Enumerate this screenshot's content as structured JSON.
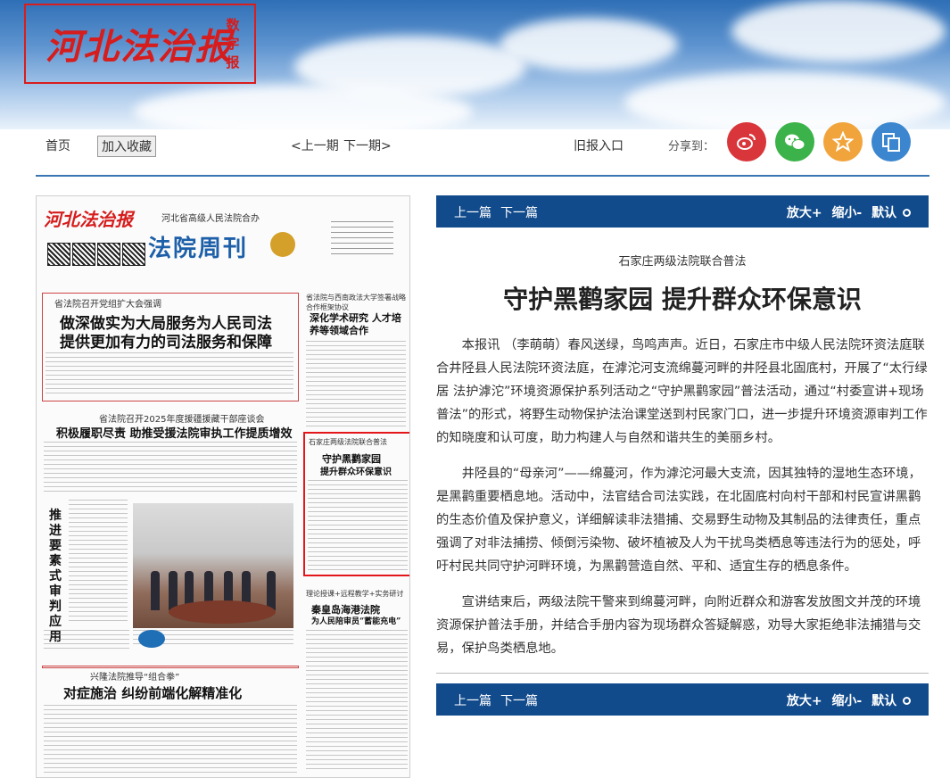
{
  "header": {
    "logo_text": "河北法治报",
    "logo_side": "数字报"
  },
  "nav": {
    "home": "首页",
    "favorite": "加入收藏",
    "prev_issue": "<上一期",
    "next_issue": "下一期>",
    "old_entry": "旧报入口",
    "share_label": "分享到："
  },
  "share": [
    {
      "name": "weibo",
      "color": "#d9363b"
    },
    {
      "name": "wechat",
      "color": "#3cb34a"
    },
    {
      "name": "qzone",
      "color": "#f1a43b"
    },
    {
      "name": "copy",
      "color": "#3b86cf"
    }
  ],
  "paper": {
    "logo": "河北法治报",
    "court": "河北省高级人民法院合办",
    "title": "法院周刊",
    "kicker1": "省法院召开党组扩大会强调",
    "headline1a": "做深做实为大局服务为人民司法",
    "headline1b": "提供更加有力的司法服务和保障",
    "kicker2": "省法院与西南政法大学签署战略合作框架协议",
    "headline2": "深化学术研究 人才培养等领域合作",
    "kicker3": "省法院召开2025年度援疆援藏干部座谈会",
    "headline3": "积极履职尽责 助推受援法院审执工作提质增效",
    "kicker4": "石家庄两级法院联合普法",
    "headline4a": "守护黑鹳家园",
    "headline4b": "提升群众环保意识",
    "headline5": "推进要素式审判 应用",
    "kicker6": "理论授课+远程教学+实务研讨",
    "headline6a": "秦皇岛海港法院",
    "headline6b": "为人民陪审员“蓄能充电”",
    "kicker7": "兴隆法院推导“组合拳”",
    "headline7": "对症施治 纠纷前端化解精准化"
  },
  "article_nav": {
    "prev": "上一篇",
    "next": "下一篇",
    "zoom_in": "放大+",
    "zoom_out": "缩小-",
    "default": "默认"
  },
  "article": {
    "kicker": "石家庄两级法院联合普法",
    "title": "守护黑鹳家园 提升群众环保意识",
    "p1": "本报讯 （李萌萌）春风送绿，鸟鸣声声。近日，石家庄市中级人民法院环资法庭联合井陉县人民法院环资法庭，在滹沱河支流绵蔓河畔的井陉县北固底村，开展了“太行绿居 法护滹沱”环境资源保护系列活动之“守护黑鹳家园”普法活动，通过“村委宣讲+现场普法”的形式，将野生动物保护法治课堂送到村民家门口，进一步提升环境资源审判工作的知晓度和认可度，助力构建人与自然和谐共生的美丽乡村。",
    "p2": "井陉县的“母亲河”——绵蔓河，作为滹沱河最大支流，因其独特的湿地生态环境，是黑鹳重要栖息地。活动中，法官结合司法实践，在北固底村向村干部和村民宣讲黑鹳的生态价值及保护意义，详细解读非法猎捕、交易野生动物及其制品的法律责任，重点强调了对非法捕捞、倾倒污染物、破坏植被及人为干扰鸟类栖息等违法行为的惩处，呼吁村民共同守护河畔环境，为黑鹳营造自然、平和、适宜生存的栖息条件。",
    "p3": "宣讲结束后，两级法院干警来到绵蔓河畔，向附近群众和游客发放图文并茂的环境资源保护普法手册，并结合手册内容为现场群众答疑解惑，劝导大家拒绝非法捕猎与交易，保护鸟类栖息地。"
  }
}
